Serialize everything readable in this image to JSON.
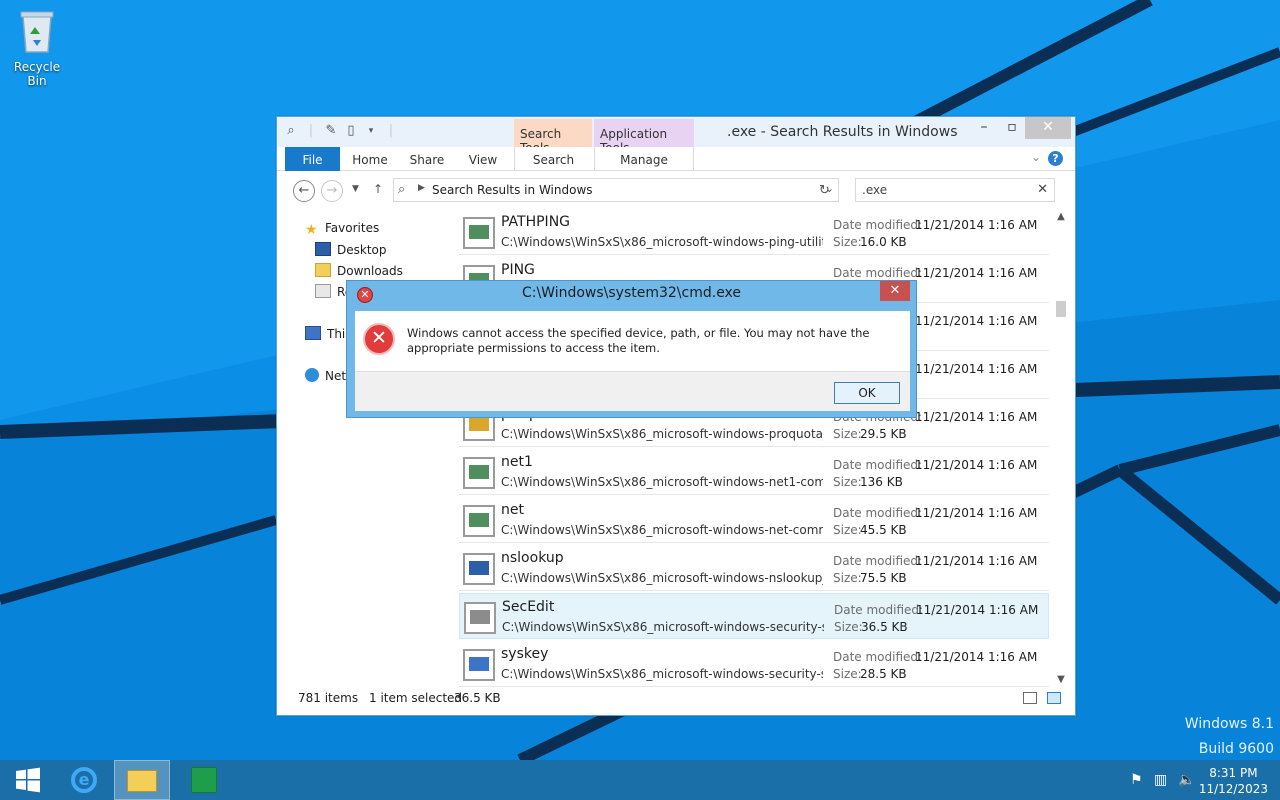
{
  "desktop": {
    "recycle_bin_label": "Recycle Bin",
    "brand_line1": "Windows 8.1",
    "brand_line2": "Build 9600"
  },
  "explorer": {
    "title": ".exe - Search Results in Windows",
    "context_tabs": {
      "search_tools": "Search Tools",
      "application_tools": "Application Tools"
    },
    "ribbon_tabs": [
      "File",
      "Home",
      "Share",
      "View",
      "Search",
      "Manage"
    ],
    "address": "Search Results in Windows",
    "search_query": ".exe",
    "nav": {
      "favorites": "Favorites",
      "desktop": "Desktop",
      "downloads": "Downloads",
      "recent": "Re",
      "this_pc": "This",
      "network": "Netw"
    },
    "files": [
      {
        "name": "PATHPING",
        "path": "C:\\Windows\\WinSxS\\x86_microsoft-windows-ping-utilitie...",
        "date_label": "Date modified:",
        "date": "11/21/2014 1:16 AM",
        "size_label": "Size:",
        "size": "16.0 KB"
      },
      {
        "name": "PING",
        "path": "",
        "date_label": "Date modified:",
        "date": "11/21/2014 1:16 AM",
        "size_label": "",
        "size": ""
      },
      {
        "name": "",
        "path": "",
        "date_label": "",
        "date": "11/21/2014 1:16 AM",
        "size_label": "",
        "size": ""
      },
      {
        "name": "",
        "path": "",
        "date_label": "",
        "date": "11/21/2014 1:16 AM",
        "size_label": "",
        "size": ""
      },
      {
        "name": "proquota",
        "path": "C:\\Windows\\WinSxS\\x86_microsoft-windows-proquota_3...",
        "date_label": "Date modified:",
        "date": "11/21/2014 1:16 AM",
        "size_label": "Size:",
        "size": "29.5 KB"
      },
      {
        "name": "net1",
        "path": "C:\\Windows\\WinSxS\\x86_microsoft-windows-net1-comm...",
        "date_label": "Date modified:",
        "date": "11/21/2014 1:16 AM",
        "size_label": "Size:",
        "size": "136 KB"
      },
      {
        "name": "net",
        "path": "C:\\Windows\\WinSxS\\x86_microsoft-windows-net-comma...",
        "date_label": "Date modified:",
        "date": "11/21/2014 1:16 AM",
        "size_label": "Size:",
        "size": "45.5 KB"
      },
      {
        "name": "nslookup",
        "path": "C:\\Windows\\WinSxS\\x86_microsoft-windows-nslookup_3...",
        "date_label": "Date modified:",
        "date": "11/21/2014 1:16 AM",
        "size_label": "Size:",
        "size": "75.5 KB"
      },
      {
        "name": "SecEdit",
        "path": "C:\\Windows\\WinSxS\\x86_microsoft-windows-security-sec...",
        "date_label": "Date modified:",
        "date": "11/21/2014 1:16 AM",
        "size_label": "Size:",
        "size": "36.5 KB"
      },
      {
        "name": "syskey",
        "path": "C:\\Windows\\WinSxS\\x86_microsoft-windows-security-sys...",
        "date_label": "Date modified:",
        "date": "11/21/2014 1:16 AM",
        "size_label": "Size:",
        "size": "28.5 KB"
      }
    ],
    "status": {
      "items": "781 items",
      "selected": "1 item selected",
      "selected_size": "36.5 KB"
    }
  },
  "dialog": {
    "title": "C:\\Windows\\system32\\cmd.exe",
    "message": "Windows cannot access the specified device, path, or file. You may not have the appropriate permissions to access the item.",
    "ok_label": "OK"
  },
  "taskbar": {
    "time": "8:31 PM",
    "date": "11/12/2023"
  }
}
